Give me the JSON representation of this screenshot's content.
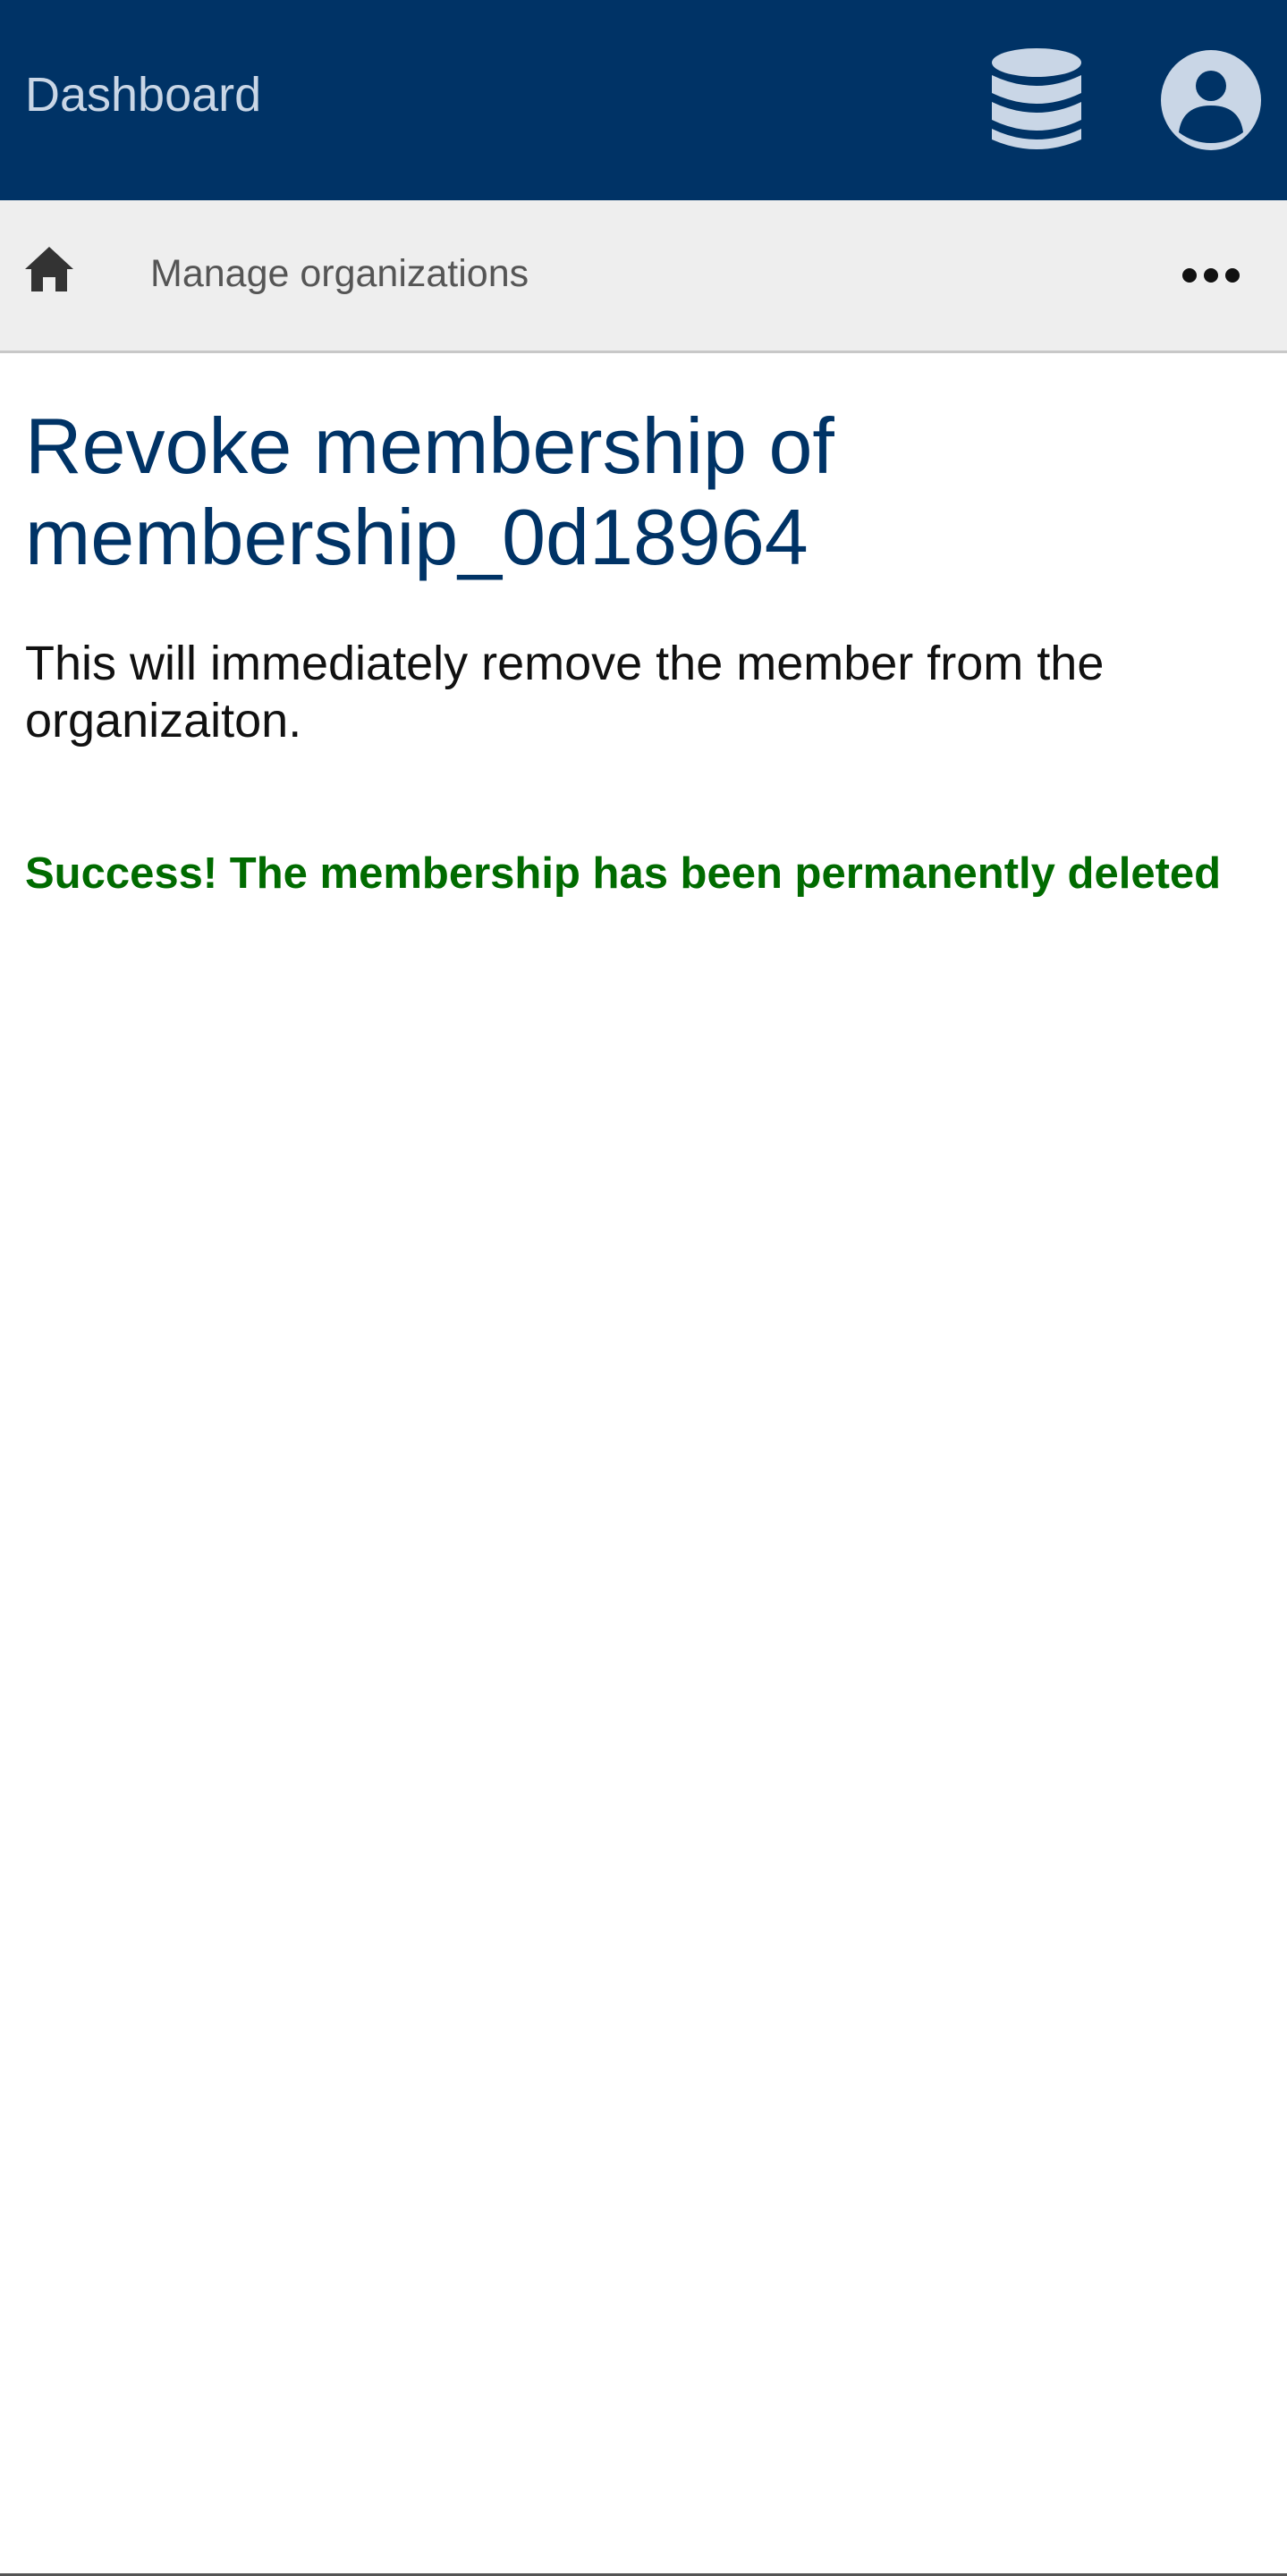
{
  "header": {
    "brand": "Dashboard",
    "icons": [
      "database-icon",
      "user-account-icon"
    ],
    "background_color": "#003366"
  },
  "breadcrumb": {
    "home_icon": "home-icon",
    "current": "Manage organizations",
    "more_icon": "more-horizontal-icon"
  },
  "main": {
    "title": "Revoke membership of membership_0d18964",
    "description": "This will immediately remove the member from the organizaiton.",
    "status_message": "Success! The membership has been permanently deleted",
    "status_color": "#006b00"
  }
}
